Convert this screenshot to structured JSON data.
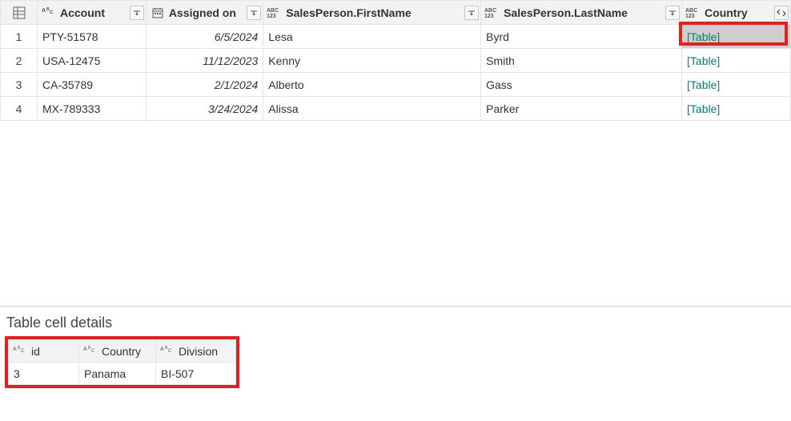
{
  "mainTable": {
    "columns": {
      "account": "Account",
      "assigned": "Assigned on",
      "first": "SalesPerson.FirstName",
      "last": "SalesPerson.LastName",
      "country": "Country"
    },
    "rows": [
      {
        "n": "1",
        "account": "PTY-51578",
        "assigned": "6/5/2024",
        "first": "Lesa",
        "last": "Byrd",
        "country": "[Table]",
        "selected": true
      },
      {
        "n": "2",
        "account": "USA-12475",
        "assigned": "11/12/2023",
        "first": "Kenny",
        "last": "Smith",
        "country": "[Table]"
      },
      {
        "n": "3",
        "account": "CA-35789",
        "assigned": "2/1/2024",
        "first": "Alberto",
        "last": "Gass",
        "country": "[Table]"
      },
      {
        "n": "4",
        "account": "MX-789333",
        "assigned": "3/24/2024",
        "first": "Alissa",
        "last": "Parker",
        "country": "[Table]"
      }
    ]
  },
  "details": {
    "title": "Table cell details",
    "columns": {
      "id": "id",
      "country": "Country",
      "division": "Division"
    },
    "row": {
      "id": "3",
      "country": "Panama",
      "division": "BI-507"
    }
  }
}
